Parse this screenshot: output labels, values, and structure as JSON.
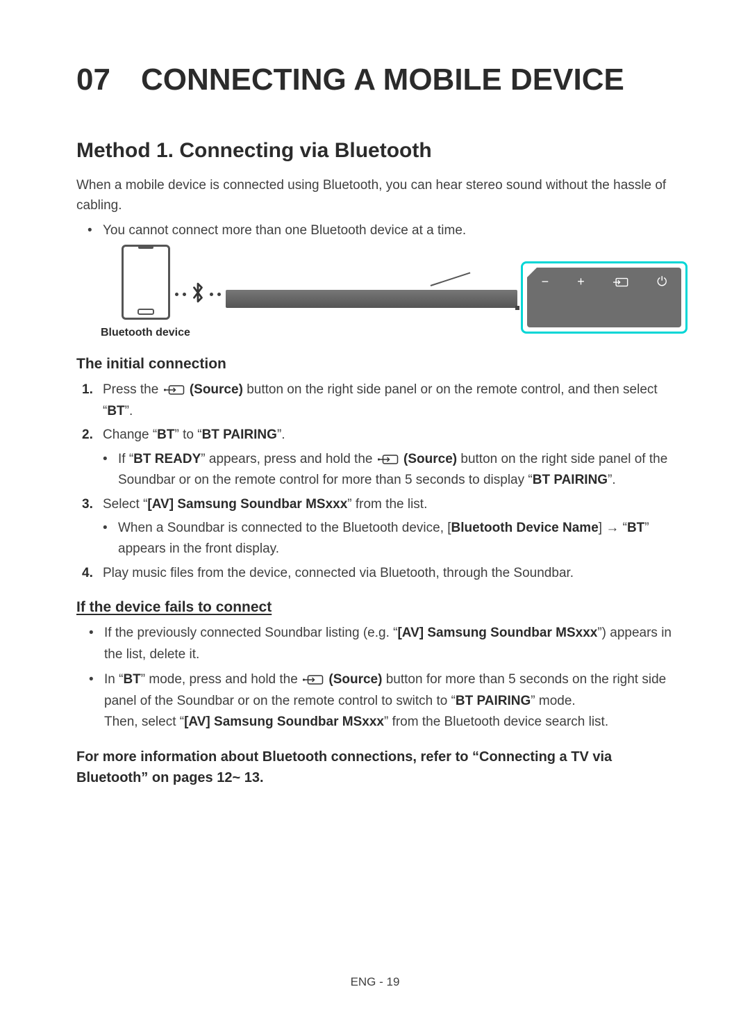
{
  "title": "07 CONNECTING A MOBILE DEVICE",
  "section1": {
    "heading": "Method 1. Connecting via Bluetooth",
    "intro": "When a mobile device is connected using Bluetooth, you can hear stereo sound without the hassle of cabling.",
    "bullet1": "You cannot connect more than one Bluetooth device at a time."
  },
  "diagram": {
    "phone_label": "Bluetooth device",
    "remote_icons": {
      "minus": "−",
      "plus": "+",
      "power": "⏻"
    }
  },
  "initial": {
    "heading": "The initial connection",
    "steps": [
      {
        "num": "1.",
        "pre": "Press the ",
        "icon_label": "(Source)",
        "post1": " button on the right side panel or on the remote control, and then select “",
        "bt": "BT",
        "post2": "”."
      },
      {
        "num": "2.",
        "pre": "Change “",
        "bt": "BT",
        "mid": "” to “",
        "btp": "BT PAIRING",
        "post": "”.",
        "sub": {
          "pre": "If “",
          "ready": "BT READY",
          "mid1": "” appears, press and hold the ",
          "icon_label": "(Source)",
          "mid2": " button on the right side panel of the Soundbar or on the remote control for more than 5 seconds to display “",
          "btp": "BT PAIRING",
          "post": "”."
        }
      },
      {
        "num": "3.",
        "pre": "Select “",
        "name": "[AV] Samsung Soundbar MSxxx",
        "post": "” from the list.",
        "sub": {
          "pre": "When a Soundbar is connected to the Bluetooth device, [",
          "bdn": "Bluetooth Device Name",
          "mid": "] → “",
          "bt": "BT",
          "post": "” appears in the front display."
        }
      },
      {
        "num": "4.",
        "text": "Play music files from the device, connected via Bluetooth, through the Soundbar."
      }
    ]
  },
  "fails": {
    "heading": "If the device fails to connect",
    "b1": {
      "pre": "If the previously connected Soundbar listing (e.g. “",
      "name": "[AV] Samsung Soundbar MSxxx",
      "post": "”) appears in the list, delete it."
    },
    "b2": {
      "pre": "In “",
      "bt": "BT",
      "mid1": "” mode, press and hold the ",
      "icon_label": "(Source)",
      "mid2": " button for more than 5 seconds on the right side panel of the Soundbar or on the remote control to switch to “",
      "btp": "BT PAIRING",
      "mid3": "” mode.",
      "line2_pre": "Then, select “",
      "name": "[AV] Samsung Soundbar MSxxx",
      "line2_post": "” from the Bluetooth device search list."
    }
  },
  "more_info": "For more information about Bluetooth connections, refer to “Connecting a TV via Bluetooth” on pages  12~ 13.",
  "footer": "ENG - 19"
}
